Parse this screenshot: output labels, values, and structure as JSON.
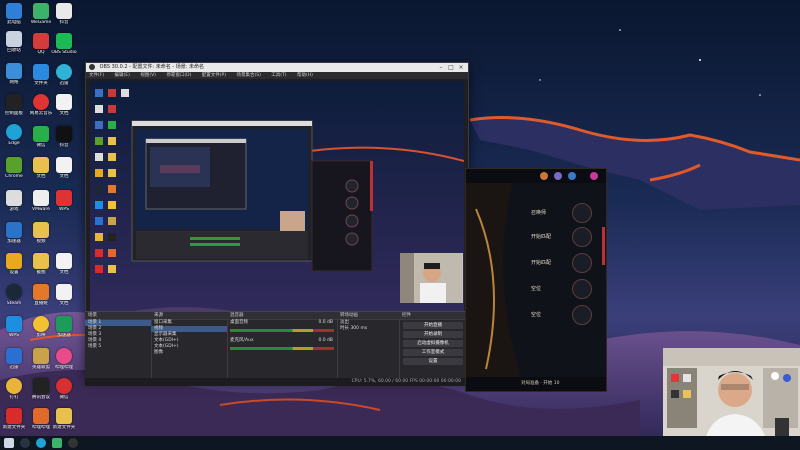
{
  "obs": {
    "title": "OBS 30.0.2 - 配置文件: 未命名 - 场景: 未命名",
    "menu": [
      "文件(F)",
      "编辑(E)",
      "视图(V)",
      "停靠窗口(D)",
      "配置文件(P)",
      "场景集合(S)",
      "工具(T)",
      "帮助(H)"
    ],
    "docks": {
      "scenes": {
        "header": "场景",
        "items": [
          "场景 1",
          "场景 2",
          "场景 3",
          "场景 4",
          "场景 5"
        ]
      },
      "sources": {
        "header": "来源",
        "items": [
          "窗口采集",
          "视频",
          "显示器采集",
          "文本(GDI+)",
          "文本(GDI+)",
          "图像"
        ]
      },
      "mixer": {
        "header": "混音器",
        "channels": [
          "桌面音频",
          "麦克风/Aux"
        ],
        "db": [
          "0.0 dB",
          "0.0 dB"
        ]
      },
      "transitions": {
        "header": "转场动画",
        "type": "淡出",
        "duration_label": "时长",
        "duration": "300 ms"
      },
      "controls": {
        "header": "控件",
        "buttons": [
          "开始直播",
          "开始录制",
          "启动虚拟摄像机",
          "工作室模式",
          "设置",
          "退出"
        ]
      }
    },
    "status": "CPU: 5.7%, 60.00 / 60.00 FPS   00:00:00   00:00:00"
  },
  "game_client": {
    "slots": [
      "召唤师",
      "开始匹配",
      "开始匹配",
      "空位",
      "空位"
    ],
    "bottom": "对局准备 · 开始 10"
  },
  "desktop": {
    "icons": [
      "此电脑",
      "回收站",
      "网络",
      "控制面板",
      "QQ",
      "微信",
      "WeGame",
      "Edge",
      "英雄联盟",
      "抖音",
      "网易云音乐",
      "Steam",
      "OBS Studio",
      "腾讯会议",
      "哔哩哔哩",
      "剪映",
      "文件夹",
      "文档",
      "VMware",
      "Chrome",
      "游戏",
      "加速器",
      "设置",
      "WPS",
      "迅雷",
      "钉钉",
      "新建文件夹",
      "视频",
      "截图",
      "直播姬"
    ]
  },
  "colors": {
    "accent": "#3c5a8a",
    "record": "#b83232",
    "wallpaper_top": "#0c1a33",
    "cloud_glow": "#e05a2a"
  }
}
